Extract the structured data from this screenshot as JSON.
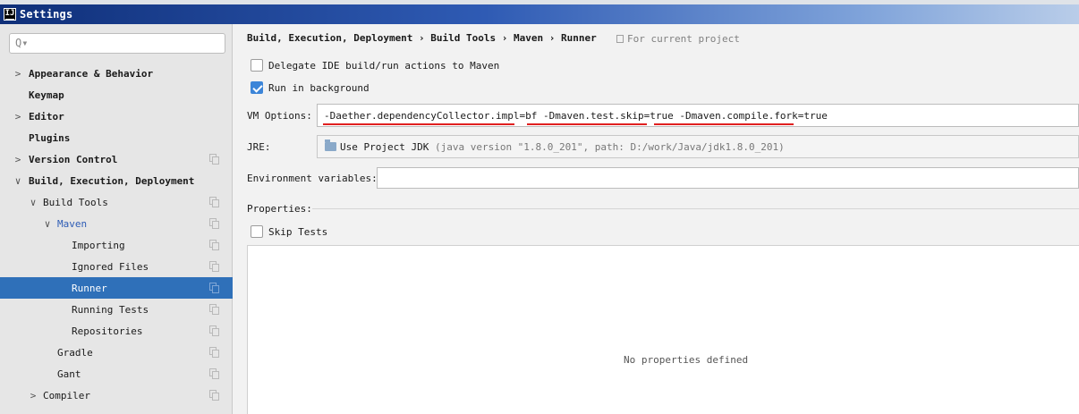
{
  "window": {
    "title": "Settings",
    "icon_letter": "IJ"
  },
  "sidebar": {
    "search_placeholder": "Q▾",
    "items": [
      {
        "label": "Appearance & Behavior",
        "arrow": ">",
        "bold": true
      },
      {
        "label": "Keymap",
        "arrow": "",
        "bold": true
      },
      {
        "label": "Editor",
        "arrow": ">",
        "bold": true
      },
      {
        "label": "Plugins",
        "arrow": "",
        "bold": true
      },
      {
        "label": "Version Control",
        "arrow": ">",
        "bold": true
      },
      {
        "label": "Build, Execution, Deployment",
        "arrow": "∨",
        "bold": true
      },
      {
        "label": "Build Tools",
        "arrow": "∨"
      },
      {
        "label": "Maven",
        "arrow": "∨"
      },
      {
        "label": "Importing"
      },
      {
        "label": "Ignored Files"
      },
      {
        "label": "Runner",
        "selected": true
      },
      {
        "label": "Running Tests"
      },
      {
        "label": "Repositories"
      },
      {
        "label": "Gradle"
      },
      {
        "label": "Gant"
      },
      {
        "label": "Compiler",
        "arrow": ">"
      }
    ]
  },
  "main": {
    "breadcrumb": "Build, Execution, Deployment › Build Tools › Maven › Runner",
    "for_project": "For current project",
    "delegate_label": "Delegate IDE build/run actions to Maven",
    "delegate_checked": false,
    "run_bg_label": "Run in background",
    "run_bg_checked": true,
    "vm_label": "VM Options:",
    "vm_value": "-Daether.dependencyCollector.impl=bf  -Dmaven.test.skip=true  -Dmaven.compile.fork=true",
    "jre_label": "JRE:",
    "jre_name": "Use Project JDK",
    "jre_detail": "(java version \"1.8.0_201\", path: D:/work/Java/jdk1.8.0_201)",
    "env_label": "Environment variables:",
    "env_value": "",
    "properties_label": "Properties:",
    "skip_tests_label": "Skip Tests",
    "skip_tests_checked": false,
    "no_properties": "No properties defined"
  },
  "colors": {
    "selection": "#2f70b9",
    "checkbox_checked": "#3c85d8",
    "annotation_underline": "#e02020"
  }
}
